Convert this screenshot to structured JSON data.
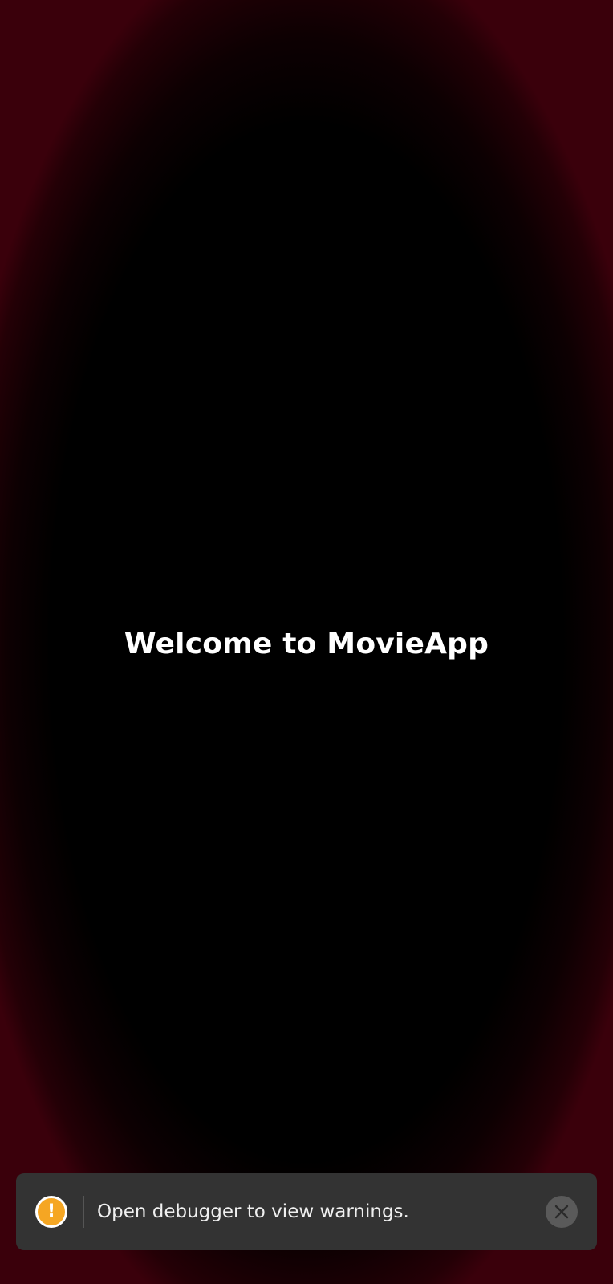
{
  "app": {
    "welcome_text": "Welcome to MovieApp"
  },
  "warning_toast": {
    "message": "Open debugger to view warnings.",
    "icon": "warning-icon",
    "icon_glyph": "!",
    "close_icon": "close-icon"
  },
  "colors": {
    "background": "#000000",
    "vignette_edge": "#3a000b",
    "toast_background": "#333333",
    "warning_accent": "#f5a623",
    "text": "#ffffff"
  }
}
